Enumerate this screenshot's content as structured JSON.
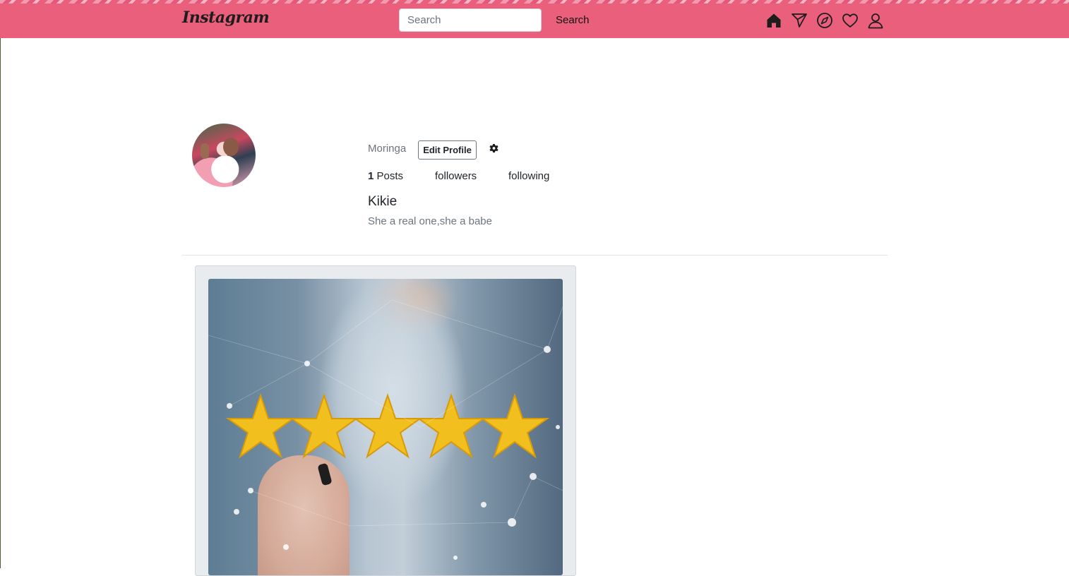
{
  "navbar": {
    "brand": "Instagram",
    "search_placeholder": "Search",
    "search_button_label": "Search",
    "icons": [
      "home-icon",
      "send-icon",
      "explore-icon",
      "heart-icon",
      "user-icon"
    ],
    "background_color": "#ea5f7c"
  },
  "profile": {
    "username": "Moringa",
    "edit_button_label": "Edit Profile",
    "settings_icon": "gear-icon",
    "stats": {
      "posts_count": "1",
      "posts_label": "Posts",
      "followers_label": "followers",
      "following_label": "following"
    },
    "full_name": "Kikie",
    "bio": "She a real one,she a babe"
  },
  "posts": [
    {
      "image_description_icon": "five-star-rating-image"
    }
  ]
}
